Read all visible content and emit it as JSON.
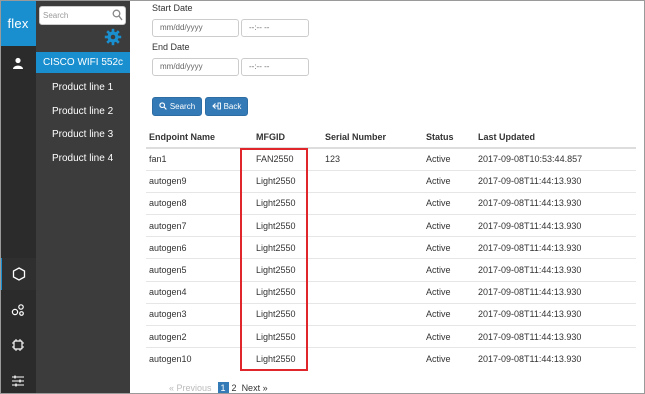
{
  "app": {
    "logo": "flex"
  },
  "sidebar": {
    "search_placeholder": "Search",
    "header": "CISCO WIFI 552c",
    "items": [
      {
        "label": "Product line 1"
      },
      {
        "label": "Product line 2"
      },
      {
        "label": "Product line 3"
      },
      {
        "label": "Product line 4"
      }
    ]
  },
  "filters": {
    "start_label": "Start Date",
    "start_date_placeholder": "mm/dd/yyyy",
    "start_time_placeholder": "--:-- --",
    "end_label": "End Date",
    "end_date_placeholder": "mm/dd/yyyy",
    "end_time_placeholder": "--:-- --",
    "search_label": "Search",
    "back_label": "Back"
  },
  "table": {
    "columns": [
      "Endpoint Name",
      "MFGID",
      "Serial Number",
      "Status",
      "Last Updated"
    ],
    "rows": [
      [
        "fan1",
        "FAN2550",
        "123",
        "Active",
        "2017-09-08T10:53:44.857"
      ],
      [
        "autogen9",
        "Light2550",
        "",
        "Active",
        "2017-09-08T11:44:13.930"
      ],
      [
        "autogen8",
        "Light2550",
        "",
        "Active",
        "2017-09-08T11:44:13.930"
      ],
      [
        "autogen7",
        "Light2550",
        "",
        "Active",
        "2017-09-08T11:44:13.930"
      ],
      [
        "autogen6",
        "Light2550",
        "",
        "Active",
        "2017-09-08T11:44:13.930"
      ],
      [
        "autogen5",
        "Light2550",
        "",
        "Active",
        "2017-09-08T11:44:13.930"
      ],
      [
        "autogen4",
        "Light2550",
        "",
        "Active",
        "2017-09-08T11:44:13.930"
      ],
      [
        "autogen3",
        "Light2550",
        "",
        "Active",
        "2017-09-08T11:44:13.930"
      ],
      [
        "autogen2",
        "Light2550",
        "",
        "Active",
        "2017-09-08T11:44:13.930"
      ],
      [
        "autogen10",
        "Light2550",
        "",
        "Active",
        "2017-09-08T11:44:13.930"
      ]
    ]
  },
  "pagination": {
    "previous": "« Previous",
    "pages": [
      "1",
      "2"
    ],
    "current": "1",
    "next": "Next »"
  },
  "colors": {
    "accent": "#1a8fd0",
    "button": "#337ab7",
    "highlight": "#e0262b"
  }
}
